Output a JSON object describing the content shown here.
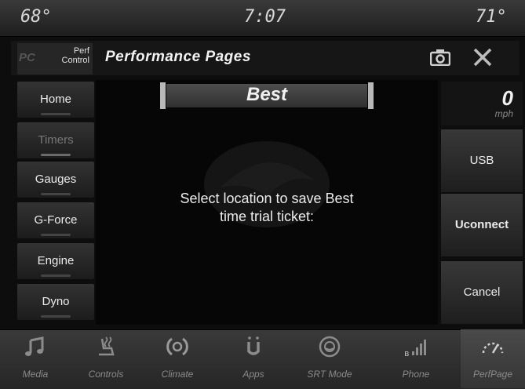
{
  "status": {
    "left_temp": "68°",
    "time": "7:07",
    "right_temp": "71°"
  },
  "header": {
    "logo_letters": "PC",
    "logo_label": "Perf Control",
    "title": "Performance Pages"
  },
  "nav": [
    {
      "label": "Home",
      "disabled": false
    },
    {
      "label": "Timers",
      "disabled": true
    },
    {
      "label": "Gauges",
      "disabled": false
    },
    {
      "label": "G-Force",
      "disabled": false
    },
    {
      "label": "Engine",
      "disabled": false
    },
    {
      "label": "Dyno",
      "disabled": false
    }
  ],
  "main": {
    "selector_label": "Best",
    "message": "Select location to save Best time trial ticket:"
  },
  "speed": {
    "value": "0",
    "unit": "mph"
  },
  "actions": {
    "usb": "USB",
    "uconnect": "Uconnect",
    "cancel": "Cancel"
  },
  "bottom_tabs": [
    {
      "label": "Media",
      "icon": "music-note-icon"
    },
    {
      "label": "Controls",
      "icon": "seat-heat-icon"
    },
    {
      "label": "Climate",
      "icon": "climate-icon"
    },
    {
      "label": "Apps",
      "icon": "apps-icon"
    },
    {
      "label": "SRT Mode",
      "icon": "steering-wheel-icon"
    },
    {
      "label": "Phone",
      "icon": "phone-signal-icon"
    },
    {
      "label": "PerfPage",
      "icon": "gauge-icon",
      "active": true
    }
  ]
}
